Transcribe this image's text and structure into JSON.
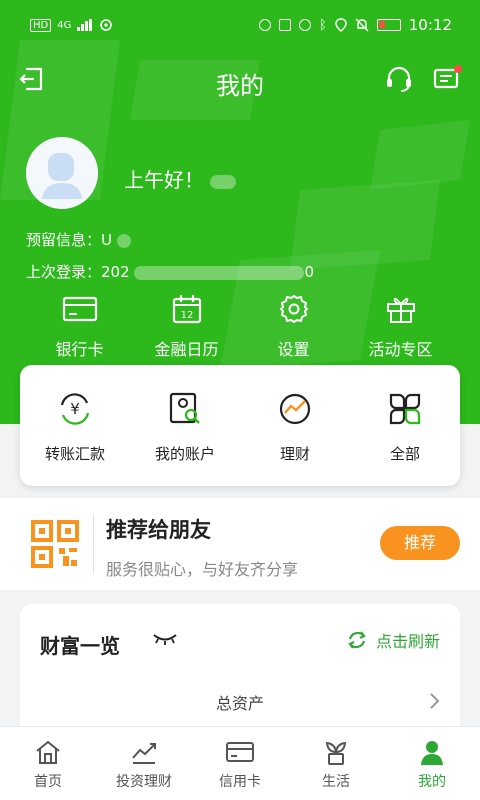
{
  "status_bar": {
    "left_badges": [
      "HD",
      "4G"
    ],
    "time": "10:12"
  },
  "nav": {
    "title": "我的"
  },
  "profile": {
    "greeting": "上午好！",
    "reserved_info_label": "预留信息：",
    "reserved_info_value": "U",
    "last_login_label": "上次登录：",
    "last_login_prefix": "202",
    "last_login_suffix": "0"
  },
  "quick_actions": [
    {
      "label": "银行卡",
      "icon": "bank-card-icon"
    },
    {
      "label": "金融日历",
      "icon": "calendar-icon"
    },
    {
      "label": "设置",
      "icon": "settings-gear-icon"
    },
    {
      "label": "活动专区",
      "icon": "gift-icon"
    }
  ],
  "calendar_day": "12",
  "main_actions": [
    {
      "label": "转账汇款",
      "icon": "transfer-icon"
    },
    {
      "label": "我的账户",
      "icon": "account-search-icon"
    },
    {
      "label": "理财",
      "icon": "wealth-chart-icon"
    },
    {
      "label": "全部",
      "icon": "all-grid-icon"
    }
  ],
  "recommend": {
    "title": "推荐给朋友",
    "subtitle": "服务很贴心，与好友齐分享",
    "button": "推荐"
  },
  "wealth": {
    "title": "财富一览",
    "refresh": "点击刷新",
    "total_assets": "总资产"
  },
  "tabs": [
    {
      "label": "首页",
      "icon": "home-icon",
      "active": false
    },
    {
      "label": "投资理财",
      "icon": "investment-chart-icon",
      "active": false
    },
    {
      "label": "信用卡",
      "icon": "credit-card-icon",
      "active": false
    },
    {
      "label": "生活",
      "icon": "plant-icon",
      "active": false
    },
    {
      "label": "我的",
      "icon": "user-icon",
      "active": true
    }
  ],
  "colors": {
    "primary_green": "#2db81c",
    "accent_green": "#2da836",
    "orange": "#f7931e",
    "notification_red": "#ff4a4a"
  }
}
